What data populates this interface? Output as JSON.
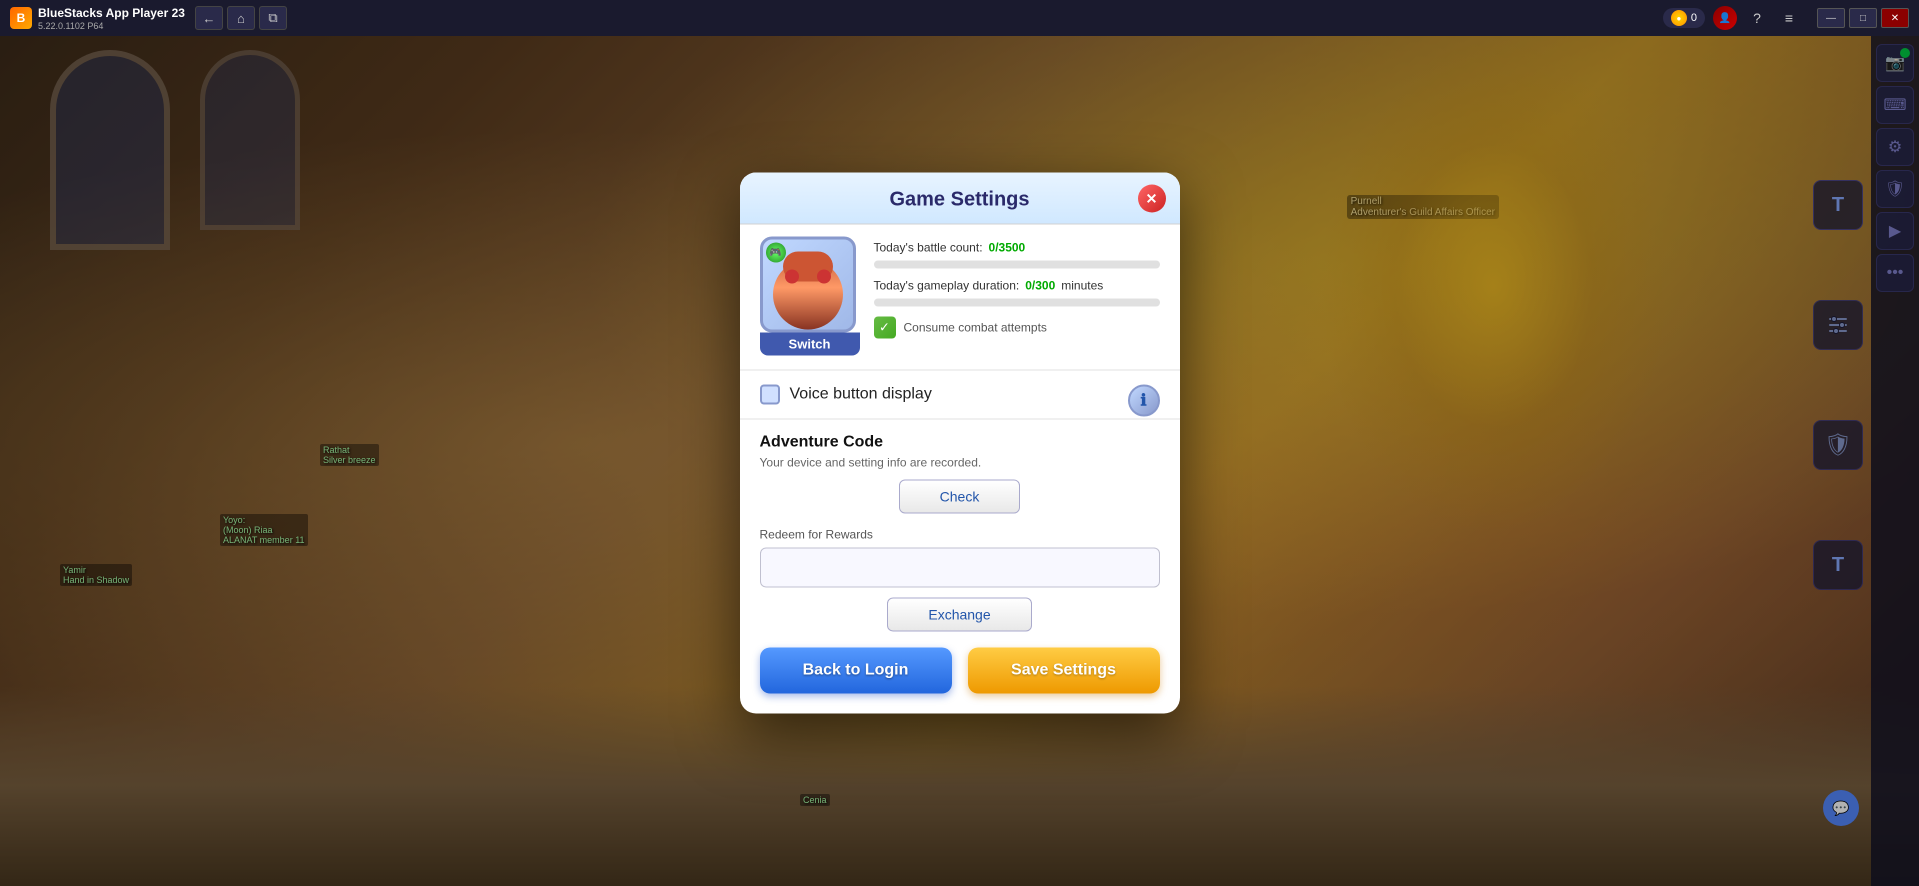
{
  "app": {
    "title": "BlueStacks App Player 23",
    "version": "5.22.0.1102  P64"
  },
  "topbar": {
    "title": "BlueStacks App Player 23",
    "version": "5.22.0.1102  P64",
    "coins": "0",
    "nav": {
      "back_label": "←",
      "home_label": "⌂",
      "tab_label": "⧉"
    },
    "controls": {
      "minimize": "—",
      "maximize": "□",
      "close": "✕",
      "help": "?",
      "menu": "≡"
    }
  },
  "sidebar": {
    "icons": [
      {
        "name": "screenshot-icon",
        "symbol": "📷"
      },
      {
        "name": "settings-icon",
        "symbol": "⚙"
      },
      {
        "name": "keyboard-icon",
        "symbol": "⌨"
      },
      {
        "name": "shield-icon",
        "symbol": "🛡"
      },
      {
        "name": "chat-icon",
        "symbol": "T"
      },
      {
        "name": "gear-panel-icon",
        "symbol": "⚙"
      },
      {
        "name": "protection-icon",
        "symbol": "🛡"
      },
      {
        "name": "chat2-icon",
        "symbol": "T"
      }
    ]
  },
  "modal": {
    "title": "Game Settings",
    "close_label": "✕",
    "avatar": {
      "switch_label": "Switch"
    },
    "stats": {
      "battle_count_label": "Today's battle count:",
      "battle_count_value": "0/3500",
      "gameplay_duration_label": "Today's gameplay duration:",
      "gameplay_duration_value": "0/300",
      "gameplay_duration_unit": "minutes"
    },
    "consume": {
      "label": "Consume combat attempts"
    },
    "info_btn": "ℹ",
    "voice": {
      "label": "Voice button display",
      "checked": false
    },
    "adventure_code": {
      "title": "Adventure Code",
      "description": "Your device and setting info are recorded.",
      "check_btn": "Check",
      "redeem_label": "Redeem for Rewards",
      "redeem_placeholder": "",
      "exchange_btn": "Exchange"
    },
    "buttons": {
      "back_to_login": "Back to Login",
      "save_settings": "Save Settings"
    }
  },
  "game": {
    "npc_name": "Purnell",
    "npc_title": "Adventurer's Guild Affairs Officer",
    "character_name": "Cenia",
    "player1": "Yamir",
    "player1_title": "Hand in Shadow",
    "player2": "Yoyo:",
    "player2_sub": "(Moon) Riaa",
    "player2_title": "ALANAT member 11",
    "player3": "Rathat",
    "player3_title": "Silver breeze"
  }
}
